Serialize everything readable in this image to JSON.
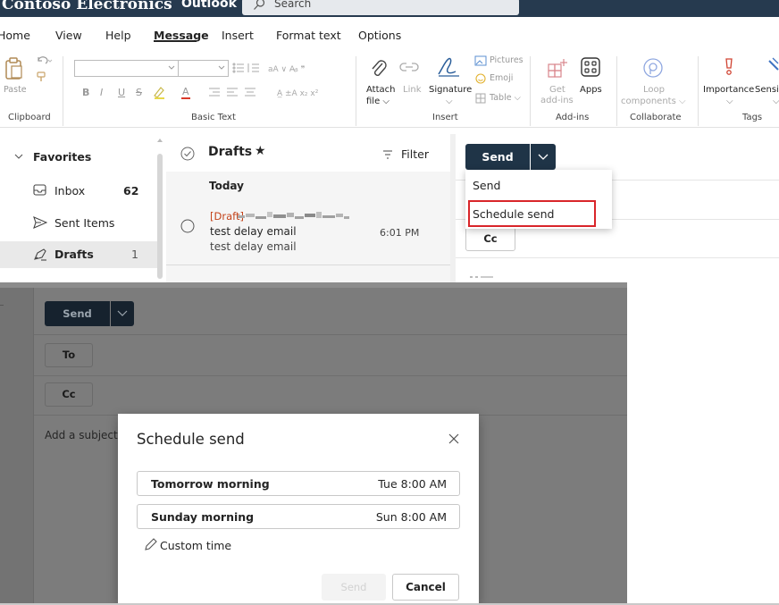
{
  "titlebar": {
    "brand": "Contoso Electronics",
    "app_name": "Outlook",
    "search_placeholder": "Search"
  },
  "menu": [
    "Home",
    "View",
    "Help",
    "Message",
    "Insert",
    "Format text",
    "Options"
  ],
  "menu_active": "Message",
  "ribbon": {
    "paste": "Paste",
    "clipboard": "Clipboard",
    "basic_text": "Basic Text",
    "format_letters": [
      "B",
      "I",
      "U",
      "S"
    ],
    "attach": "Attach",
    "file": "file",
    "link": "Link",
    "signature": "Signature",
    "pictures": "Pictures",
    "emoji": "Emoji",
    "table": "Table",
    "insert": "Insert",
    "get": "Get",
    "add_ins_small": "add-ins",
    "apps": "Apps",
    "add_ins": "Add-ins",
    "loop": "Loop",
    "components": "components",
    "collaborate": "Collaborate",
    "importance": "Importance",
    "sensitivity": "Sensit",
    "tags": "Tags"
  },
  "nav": {
    "favorites": "Favorites",
    "items": [
      {
        "label": "Inbox",
        "count": "62"
      },
      {
        "label": "Sent Items",
        "count": ""
      },
      {
        "label": "Drafts",
        "count": "1"
      }
    ]
  },
  "msglist": {
    "title": "Drafts",
    "filter": "Filter",
    "group": "Today",
    "message": {
      "draft_tag": "[Draft]",
      "subject": "test delay email",
      "preview": "test delay email",
      "time": "6:01 PM"
    }
  },
  "compose": {
    "send": "Send",
    "cc": "Cc",
    "to": "To",
    "subject_placeholder": "Add a subject",
    "dropdown": {
      "items": [
        "Send",
        "Schedule send"
      ]
    }
  },
  "dialog": {
    "title": "Schedule send",
    "options": [
      {
        "label": "Tomorrow morning",
        "time": "Tue 8:00 AM"
      },
      {
        "label": "Sunday morning",
        "time": "Sun 8:00 AM"
      }
    ],
    "custom_time": "Custom time",
    "send": "Send",
    "cancel": "Cancel"
  },
  "colors": {
    "titlebar": "#263a4f",
    "send_button": "#1f3447",
    "highlight": "#d9252a",
    "draft_tag": "#c4441b"
  }
}
